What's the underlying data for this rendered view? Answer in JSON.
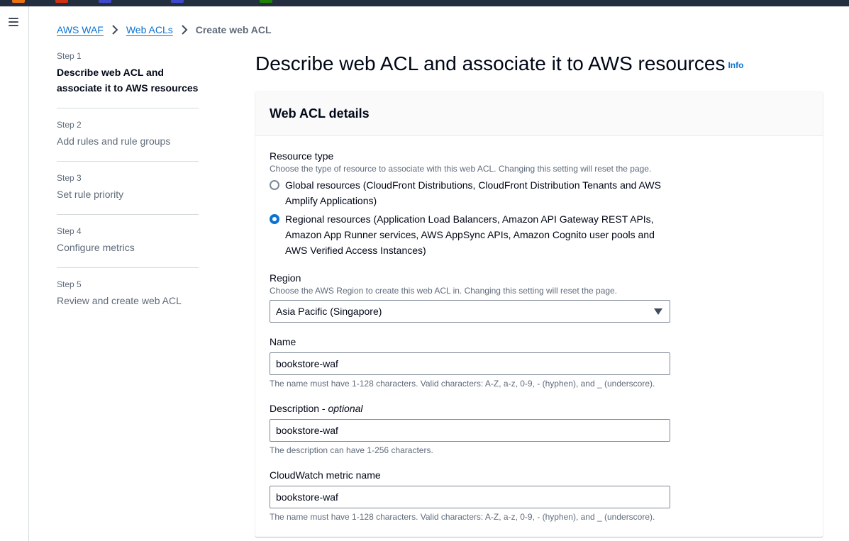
{
  "topbar": {
    "chips": [
      {
        "color": "#ec7211"
      },
      {
        "color": "#d13212"
      },
      {
        "color": "#3f48cc"
      },
      {
        "color": "#3f48cc"
      },
      {
        "color": "#1d8102"
      }
    ]
  },
  "breadcrumb": {
    "items": [
      "AWS WAF",
      "Web ACLs"
    ],
    "current": "Create web ACL"
  },
  "steps": [
    {
      "label": "Step 1",
      "title": "Describe web ACL and associate it to AWS resources"
    },
    {
      "label": "Step 2",
      "title": "Add rules and rule groups"
    },
    {
      "label": "Step 3",
      "title": "Set rule priority"
    },
    {
      "label": "Step 4",
      "title": "Configure metrics"
    },
    {
      "label": "Step 5",
      "title": "Review and create web ACL"
    }
  ],
  "page": {
    "title": "Describe web ACL and associate it to AWS resources",
    "info": "Info"
  },
  "panel": {
    "title": "Web ACL details"
  },
  "resource_type": {
    "label": "Resource type",
    "description": "Choose the type of resource to associate with this web ACL. Changing this setting will reset the page.",
    "options": [
      {
        "label": "Global resources (CloudFront Distributions, CloudFront Distribution Tenants and AWS Amplify Applications)",
        "checked": false
      },
      {
        "label": "Regional resources (Application Load Balancers, Amazon API Gateway REST APIs, Amazon App Runner services, AWS AppSync APIs, Amazon Cognito user pools and AWS Verified Access Instances)",
        "checked": true
      }
    ]
  },
  "region": {
    "label": "Region",
    "description": "Choose the AWS Region to create this web ACL in. Changing this setting will reset the page.",
    "selected": "Asia Pacific (Singapore)"
  },
  "name": {
    "label": "Name",
    "value": "bookstore-waf",
    "constraint": "The name must have 1-128 characters. Valid characters: A-Z, a-z, 0-9, - (hyphen), and _ (underscore)."
  },
  "description": {
    "label": "Description",
    "optional": "optional",
    "value": "bookstore-waf",
    "constraint": "The description can have 1-256 characters."
  },
  "metric_name": {
    "label": "CloudWatch metric name",
    "value": "bookstore-waf",
    "constraint": "The name must have 1-128 characters. Valid characters: A-Z, a-z, 0-9, - (hyphen), and _ (underscore)."
  }
}
